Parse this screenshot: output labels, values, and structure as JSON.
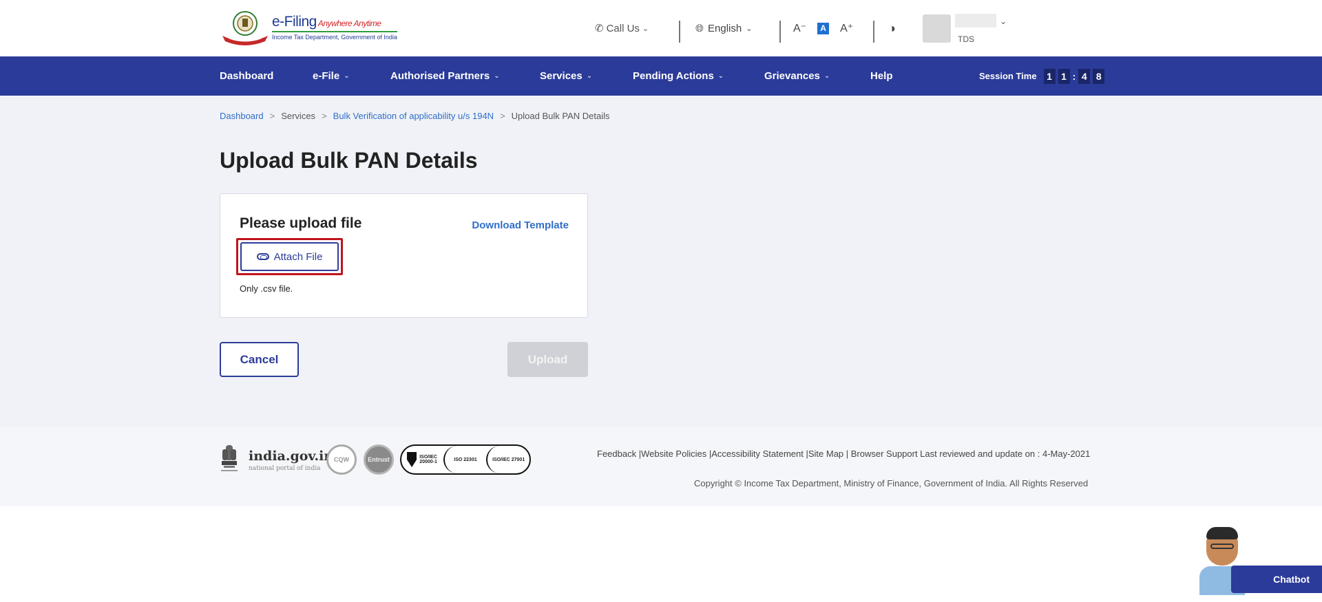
{
  "header": {
    "logo_title": "e-Filing",
    "logo_tagline": "Anywhere Anytime",
    "logo_subtitle": "Income Tax Department, Government of India",
    "call_us": "Call Us",
    "language": "English",
    "font_decrease": "A⁻",
    "font_default": "A",
    "font_increase": "A⁺",
    "contrast_icon": "contrast-icon",
    "user_role": "TDS"
  },
  "nav": {
    "items": [
      {
        "label": "Dashboard",
        "has_dropdown": false
      },
      {
        "label": "e-File",
        "has_dropdown": true
      },
      {
        "label": "Authorised Partners",
        "has_dropdown": true
      },
      {
        "label": "Services",
        "has_dropdown": true
      },
      {
        "label": "Pending Actions",
        "has_dropdown": true
      },
      {
        "label": "Grievances",
        "has_dropdown": true
      },
      {
        "label": "Help",
        "has_dropdown": false
      }
    ],
    "session_label": "Session Time",
    "session_digits": [
      "1",
      "1",
      "4",
      "8"
    ]
  },
  "breadcrumb": {
    "items": [
      {
        "label": "Dashboard",
        "link": true
      },
      {
        "label": "Services",
        "link": false
      },
      {
        "label": "Bulk Verification of applicability u/s 194N",
        "link": true
      },
      {
        "label": "Upload Bulk PAN Details",
        "link": false
      }
    ],
    "separator": ">"
  },
  "page": {
    "title": "Upload Bulk PAN Details"
  },
  "upload_card": {
    "title": "Please upload file",
    "download_template": "Download Template",
    "attach_label": "Attach File",
    "hint": "Only .csv file."
  },
  "actions": {
    "cancel": "Cancel",
    "upload": "Upload"
  },
  "footer": {
    "portal_name": "india.gov.in",
    "portal_sub": "national portal of india",
    "cqw": "CQW",
    "entrust": "Entrust",
    "iso_1": "ISO/IEC 20000-1",
    "iso_2": "ISO 22301",
    "iso_3": "ISO/IEC 27001",
    "links": "Feedback |Website Policies |Accessibility Statement |Site Map | Browser Support   Last reviewed and update on : 4-May-2021",
    "copyright": "Copyright © Income Tax Department, Ministry of Finance, Government of India. All Rights Reserved"
  },
  "chatbot": {
    "label": "Chatbot"
  },
  "colors": {
    "nav_bg": "#2b3b99",
    "link": "#2f6ec9",
    "highlight": "#c0141c",
    "page_bg": "#f0f2f7"
  }
}
